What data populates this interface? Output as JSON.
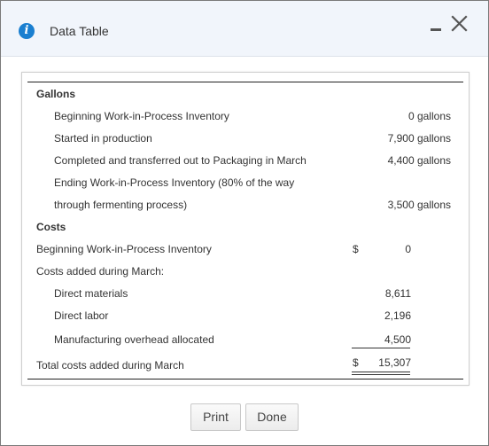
{
  "window": {
    "title": "Data Table",
    "icon": "info-icon"
  },
  "table": {
    "gallons_header": "Gallons",
    "rows_gallons": [
      {
        "label": "Beginning Work-in-Process Inventory",
        "value": "0 gallons"
      },
      {
        "label": "Started in production",
        "value": "7,900 gallons"
      },
      {
        "label": "Completed and transferred out to Packaging in March",
        "value": "4,400 gallons"
      },
      {
        "label": "Ending Work-in-Process Inventory (80% of the way",
        "value": ""
      },
      {
        "label": "through fermenting process)",
        "value": "3,500 gallons"
      }
    ],
    "costs_header": "Costs",
    "beginning_wip": {
      "label": "Beginning Work-in-Process Inventory",
      "currency": "$",
      "value": "0"
    },
    "costs_added_label": "Costs added during March:",
    "cost_items": [
      {
        "label": "Direct materials",
        "value": "8,611"
      },
      {
        "label": "Direct labor",
        "value": "2,196"
      },
      {
        "label": "Manufacturing overhead allocated",
        "value": "4,500"
      }
    ],
    "total": {
      "label": "Total costs added during March",
      "currency": "$",
      "value": "15,307"
    }
  },
  "buttons": {
    "print": "Print",
    "done": "Done"
  }
}
